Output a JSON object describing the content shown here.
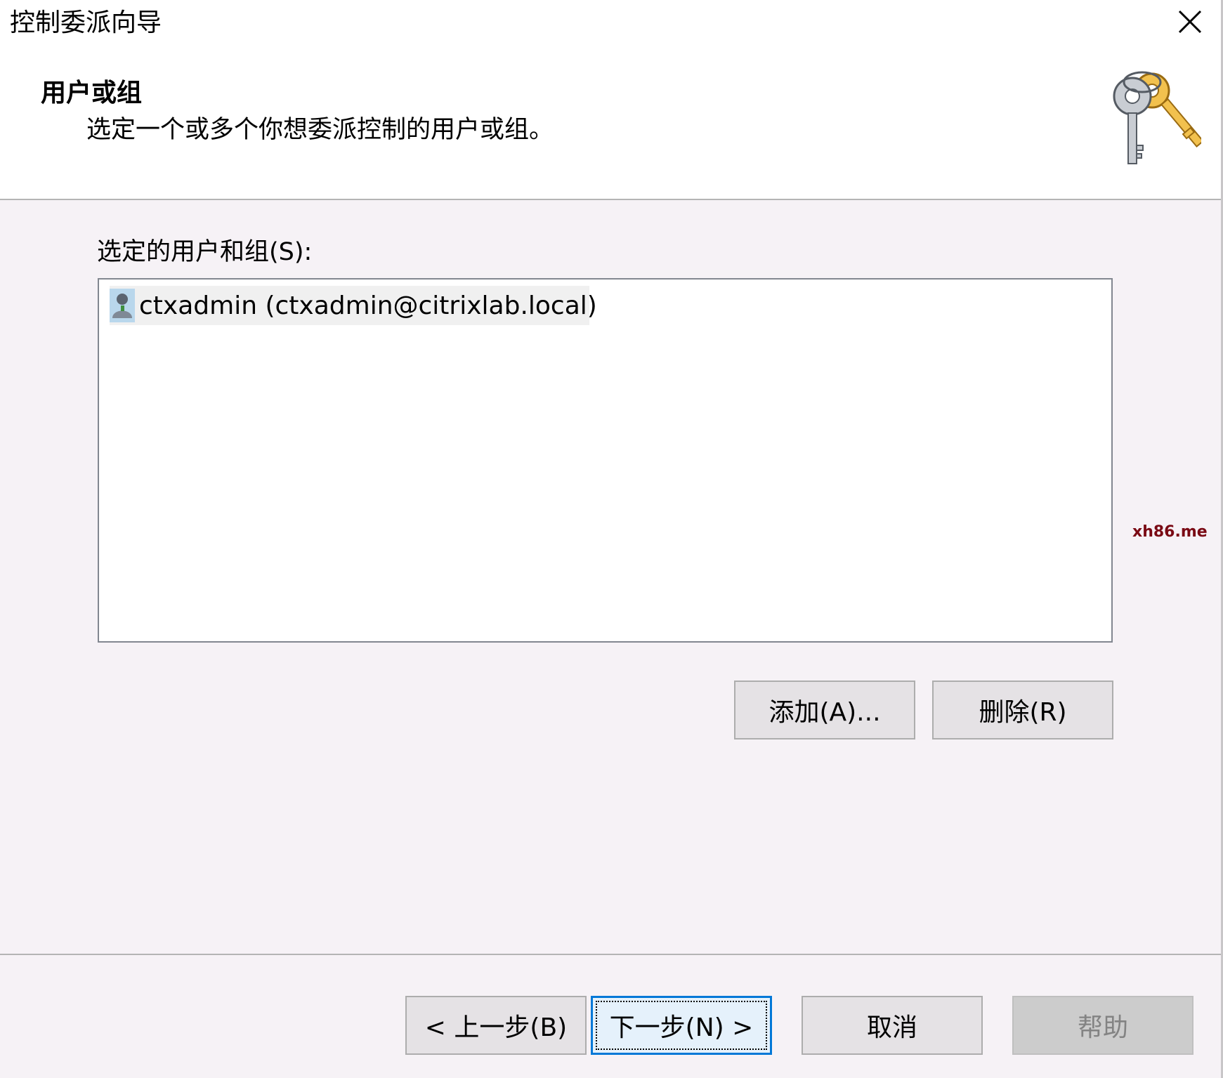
{
  "window": {
    "title": "控制委派向导"
  },
  "header": {
    "heading": "用户或组",
    "subtitle": "选定一个或多个你想委派控制的用户或组。",
    "icon": "keys-icon"
  },
  "selected_list": {
    "label": "选定的用户和组(S):",
    "items": [
      {
        "icon": "user-icon",
        "text": "ctxadmin (ctxadmin@citrixlab.local)"
      }
    ]
  },
  "list_buttons": {
    "add": "添加(A)...",
    "remove": "删除(R)"
  },
  "watermark": "xh86.me",
  "footer": {
    "back": "< 上一步(B)",
    "next": "下一步(N) >",
    "cancel": "取消",
    "help": "帮助"
  },
  "colors": {
    "focus_border": "#0078d7",
    "watermark": "#7a0a14"
  }
}
